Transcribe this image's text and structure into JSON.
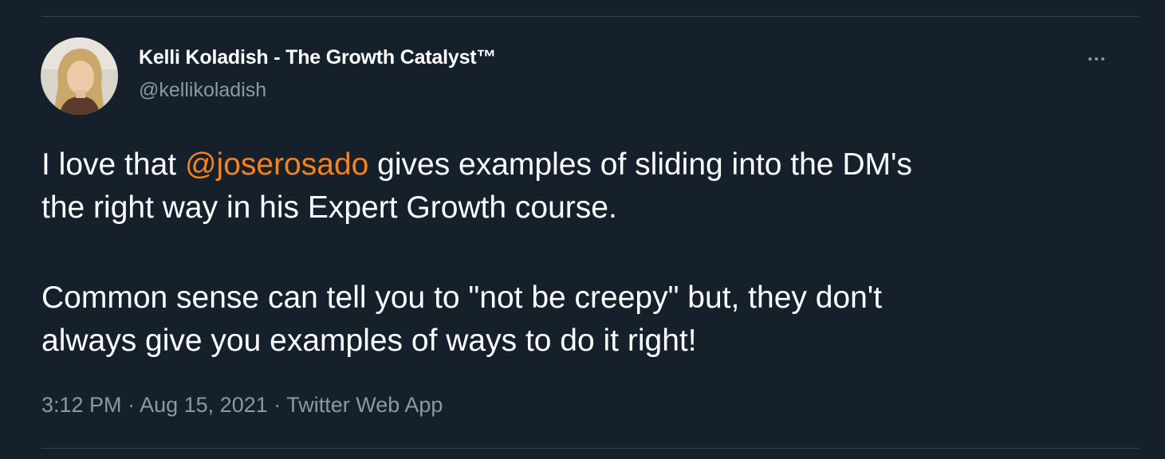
{
  "author": {
    "display_name": "Kelli Koladish - The Growth Catalyst™",
    "handle": "@kellikoladish"
  },
  "tweet": {
    "line1_before": "I love that ",
    "mention": "@joserosado",
    "line1_after": " gives examples of sliding into the DM's",
    "line2": "the right way in his Expert Growth course.",
    "line3": "Common sense can tell you to \"not be creepy\" but, they don't",
    "line4": "always give you examples of ways to do it right!"
  },
  "meta": {
    "time": "3:12 PM",
    "date": "Aug 15, 2021",
    "source": "Twitter Web App",
    "separator": "·"
  },
  "icons": {
    "more": "more-options-icon"
  },
  "colors": {
    "background": "#15202b",
    "text": "#ffffff",
    "secondary": "#8b98a5",
    "accent": "#f7821b",
    "divider": "#38444d"
  }
}
